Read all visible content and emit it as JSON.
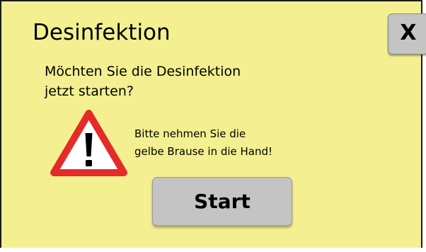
{
  "dialog": {
    "title": "Desinfektion",
    "close_label": "X",
    "message_line1": "Möchten Sie die Desinfektion",
    "message_line2": "jetzt starten?",
    "hint_line1": "Bitte nehmen Sie die",
    "hint_line2": "gelbe Brause in die Hand!",
    "warning_icon": "warning-triangle-icon",
    "start_label": "Start"
  },
  "colors": {
    "background": "#f4f091",
    "button": "#c4c4c4",
    "warning_red": "#e52a2a"
  }
}
